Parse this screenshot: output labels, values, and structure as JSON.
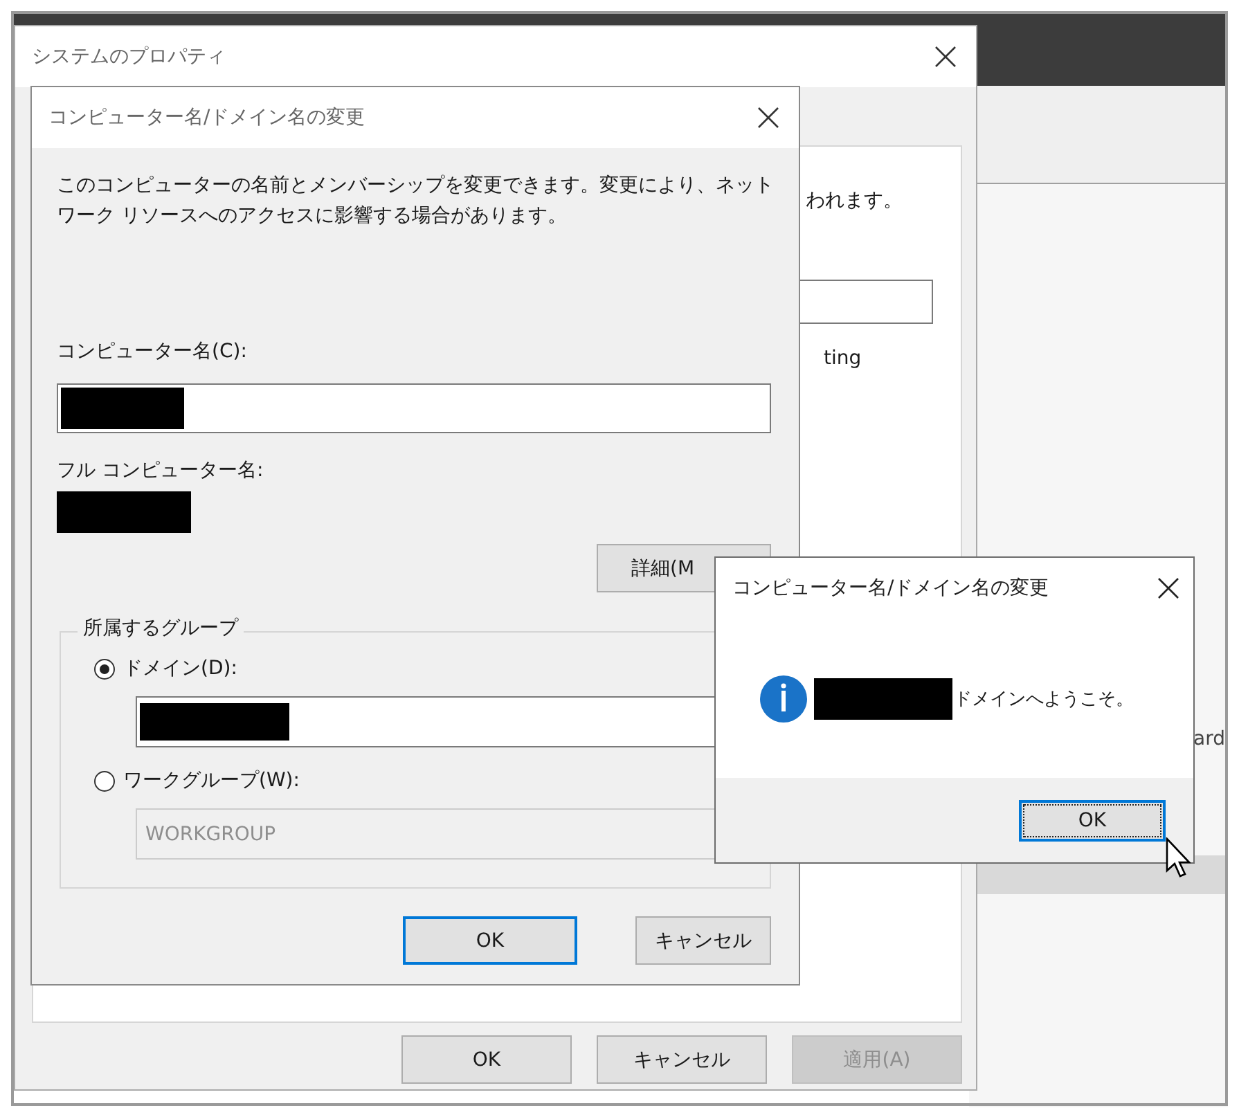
{
  "background_window": {
    "partial_text": "ard"
  },
  "system_properties": {
    "title": "システムのプロパティ",
    "page_texts": [
      "われます。",
      "ting"
    ],
    "buttons": [
      {
        "label": "OK",
        "disabled": false
      },
      {
        "label": "キャンセル",
        "disabled": false
      },
      {
        "label": "適用(A)",
        "disabled": true
      }
    ]
  },
  "change_dialog": {
    "title": "コンピューター名/ドメイン名の変更",
    "description": "このコンピューターの名前とメンバーシップを変更できます。変更により、ネットワーク リソースへのアクセスに影響する場合があります。",
    "computer_name_label": "コンピューター名(C):",
    "full_name_label": "フル コンピューター名:",
    "more_button": "詳細(M",
    "member_of": {
      "legend": "所属するグループ",
      "options": [
        {
          "label": "ドメイン(D):",
          "selected": true
        },
        {
          "label": "ワークグループ(W):",
          "selected": false,
          "value": "WORKGROUP"
        }
      ]
    },
    "buttons": [
      {
        "label": "OK",
        "default": true
      },
      {
        "label": "キャンセル",
        "default": false
      }
    ]
  },
  "message_box": {
    "title": "コンピューター名/ドメイン名の変更",
    "message": "ドメインへようこそ。",
    "button": {
      "label": "OK",
      "focused": true
    }
  }
}
